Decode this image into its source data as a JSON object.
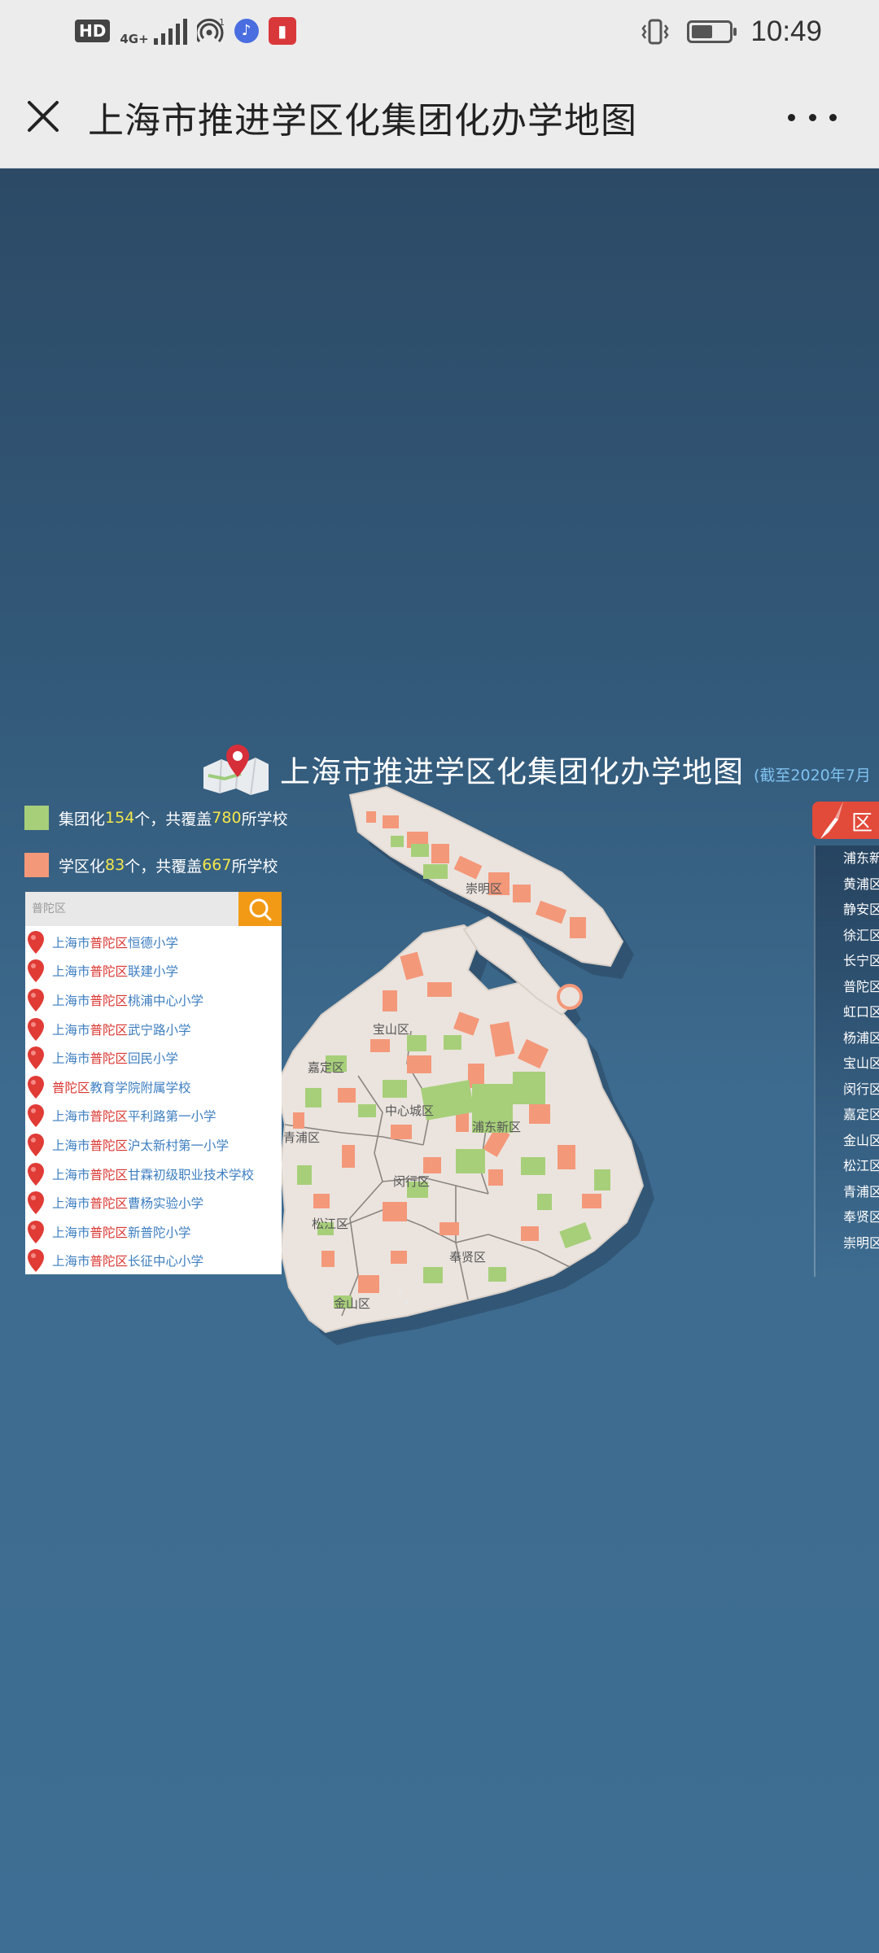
{
  "status_bar": {
    "hd": "HD",
    "network": "4G+",
    "hotspot_count": "1",
    "time": "10:49",
    "battery_level": 0.55
  },
  "header": {
    "title": "上海市推进学区化集团化办学地图"
  },
  "map": {
    "title": "上海市推进学区化集团化办学地图",
    "subtitle": "(截至2020年7月",
    "legend": [
      {
        "label": "集团化 ",
        "count": "154",
        "mid": "个，共覆盖 ",
        "schools": "780",
        "suffix": "所学校",
        "color": "#a7cf7a"
      },
      {
        "label": "学区化 ",
        "count": "83",
        "mid": "个，共覆盖 ",
        "schools": "667",
        "suffix": "所学校",
        "color": "#f4987a"
      }
    ],
    "district_labels": [
      "崇明区",
      "宝山区",
      "嘉定区",
      "中心城区",
      "浦东新区",
      "青浦区",
      "闵行区",
      "松江区",
      "奉贤区",
      "金山区"
    ]
  },
  "search": {
    "placeholder": "普陀区",
    "results": [
      {
        "city": "上海市",
        "district": "普陀区",
        "name": "恒德小学"
      },
      {
        "city": "上海市",
        "district": "普陀区",
        "name": "联建小学"
      },
      {
        "city": "上海市",
        "district": "普陀区",
        "name": "桃浦中心小学"
      },
      {
        "city": "上海市",
        "district": "普陀区",
        "name": "武宁路小学"
      },
      {
        "city": "上海市",
        "district": "普陀区",
        "name": "回民小学"
      },
      {
        "city": "",
        "district": "普陀区",
        "name": "教育学院附属学校"
      },
      {
        "city": "上海市",
        "district": "普陀区",
        "name": "平利路第一小学"
      },
      {
        "city": "上海市",
        "district": "普陀区",
        "name": "沪太新村第一小学"
      },
      {
        "city": "上海市",
        "district": "普陀区",
        "name": "甘霖初级职业技术学校"
      },
      {
        "city": "上海市",
        "district": "普陀区",
        "name": "曹杨实验小学"
      },
      {
        "city": "上海市",
        "district": "普陀区",
        "name": "新普陀小学"
      },
      {
        "city": "上海市",
        "district": "普陀区",
        "name": "长征中心小学"
      }
    ]
  },
  "district_panel": {
    "header": "区",
    "items": [
      "浦东新",
      "黄浦区",
      "静安区",
      "徐汇区",
      "长宁区",
      "普陀区",
      "虹口区",
      "杨浦区",
      "宝山区",
      "闵行区",
      "嘉定区",
      "金山区",
      "松江区",
      "青浦区",
      "奉贤区",
      "崇明区"
    ]
  }
}
